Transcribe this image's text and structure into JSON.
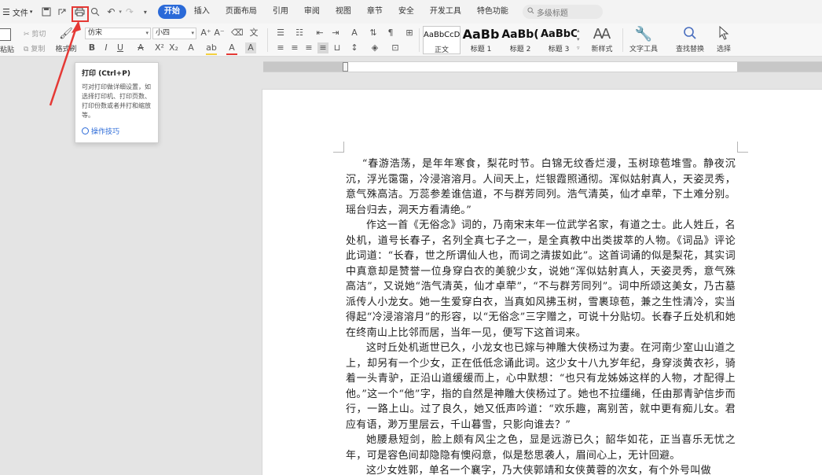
{
  "menubar": {
    "menu_icon": "hamburger-icon",
    "file_label": "文件",
    "tabs": [
      "开始",
      "插入",
      "页面布局",
      "引用",
      "审阅",
      "视图",
      "章节",
      "安全",
      "开发工具",
      "特色功能"
    ],
    "active_tab": "开始",
    "search_placeholder": "多级标题"
  },
  "ribbon": {
    "paste_label": "粘贴",
    "cut_label": "剪切",
    "copy_label": "复制",
    "format_painter_label": "格式刷",
    "font_name": "仿宋",
    "font_size": "小四",
    "styles": [
      {
        "sample": "AaBbCcDd",
        "label": "正文"
      },
      {
        "sample": "AaBb",
        "label": "标题 1"
      },
      {
        "sample": "AaBb(",
        "label": "标题 2"
      },
      {
        "sample": "AaBbC",
        "label": "标题 3"
      }
    ],
    "new_style_label": "新样式",
    "text_tools_label": "文字工具",
    "find_replace_label": "查找替换",
    "select_label": "选择"
  },
  "tooltip": {
    "title": "打印 (Ctrl+P)",
    "description": "可对打印做详细设置，如选择打印机、打印页数、打印份数或者并打和缩放等。",
    "link": "操作技巧"
  },
  "document": {
    "paragraphs": [
      "“春游浩荡，是年年寒食，梨花时节。白锦无纹香烂漫，玉树琼苞堆雪。静夜沉沉，浮光霭霭，冷浸溶溶月。人间天上，烂银霞照通彻。浑似姑射真人，天姿灵秀，意气殊高洁。万蕊参差谁信道，不与群芳同列。浩气清英，仙才卓荦，下土难分别。瑶台归去，洞天方看清绝。”",
      "作这一首《无俗念》词的，乃南宋末年一位武学名家，有道之士。此人姓丘，名处机，道号长春子，名列全真七子之一，是全真教中出类拔萃的人物。《词品》评论此词道：“长春，世之所谓仙人也，而词之清拔如此”。这首词诵的似是梨花，其实词中真意却是赞誉一位身穿白衣的美貌少女，说她“浑似姑射真人，天姿灵秀，意气殊高洁”，又说她“浩气清英，仙才卓荦”，“不与群芳同列”。词中所颂这美女，乃古墓派传人小龙女。她一生爱穿白衣，当真如风拂玉树，雪裹琼苞，兼之生性清冷，实当得起“冷浸溶溶月”的形容，以“无俗念”三字赠之，可说十分贴切。长春子丘处机和她在终南山上比邻而居，当年一见，便写下这首词来。",
      "这时丘处机逝世已久，小龙女也已嫁与神雕大侠杨过为妻。在河南少室山山道之上，却另有一个少女，正在低低念诵此词。这少女十八九岁年纪，身穿淡黄衣衫，骑着一头青驴，正沿山道缓缓而上，心中默想：“也只有龙姊姊这样的人物，才配得上他。”这一个“他”字，指的自然是神雕大侠杨过了。她也不拉缰绳，任由那青驴信步而行，一路上山。过了良久，她又低声吟道：“欢乐趣，离别苦，就中更有痴儿女。君应有语，渺万里层云，千山暮雪，只影向谁去？”",
      "她腰悬短剑，脸上颇有风尘之色，显是远游已久；韶华如花，正当喜乐无忧之年，可是容色间却隐隐有懊闷意，似是愁思袭人，眉间心上，无计回避。",
      "这少女姓郭，单名一个襄字，乃大侠郭靖和女侠黄蓉的次女，有个外号叫做"
    ]
  }
}
